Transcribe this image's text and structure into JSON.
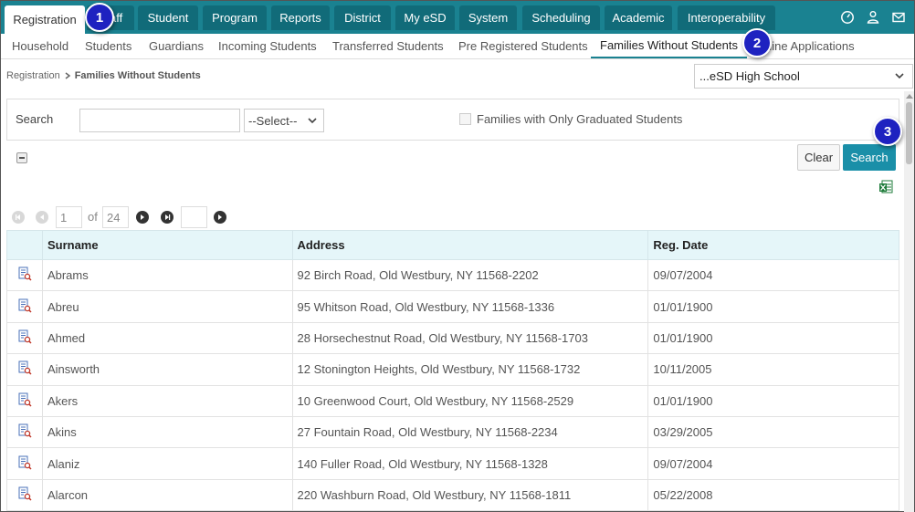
{
  "topnav": {
    "tabs": [
      {
        "label": "Registration",
        "active": true
      },
      {
        "label": "Staff",
        "active": false
      },
      {
        "label": "Student",
        "active": false
      },
      {
        "label": "Program",
        "active": false
      },
      {
        "label": "Reports",
        "active": false
      },
      {
        "label": "District",
        "active": false
      },
      {
        "label": "My eSD",
        "active": false
      },
      {
        "label": "System",
        "active": false
      },
      {
        "label": "Scheduling",
        "active": false
      },
      {
        "label": "Academic",
        "active": false
      },
      {
        "label": "Interoperability",
        "active": false
      }
    ],
    "icons": [
      "dashboard-icon",
      "user-settings-icon",
      "mail-icon"
    ]
  },
  "subnav": {
    "tabs": [
      {
        "label": "Household",
        "active": false
      },
      {
        "label": "Students",
        "active": false
      },
      {
        "label": "Guardians",
        "active": false
      },
      {
        "label": "Incoming Students",
        "active": false
      },
      {
        "label": "Transferred Students",
        "active": false
      },
      {
        "label": "Pre Registered Students",
        "active": false
      },
      {
        "label": "Families Without Students",
        "active": true
      },
      {
        "label": "Online Applications",
        "active": false
      }
    ]
  },
  "breadcrumb": {
    "root": "Registration",
    "current": "Families Without Students"
  },
  "school_select": {
    "value": "...eSD High School"
  },
  "search": {
    "label": "Search",
    "input_value": "",
    "select_value": "--Select--",
    "checkbox_label": "Families with Only Graduated Students",
    "checkbox_checked": false,
    "clear_label": "Clear",
    "search_label": "Search"
  },
  "pager": {
    "current_page": "1",
    "of_label": "of",
    "total_pages": "24",
    "goto_value": ""
  },
  "table": {
    "columns": [
      "",
      "Surname",
      "Address",
      "Reg. Date"
    ],
    "rows": [
      {
        "surname": "Abrams",
        "address": "92 Birch Road, Old Westbury, NY 11568-2202",
        "reg_date": "09/07/2004"
      },
      {
        "surname": "Abreu",
        "address": "95 Whitson Road, Old Westbury, NY 11568-1336",
        "reg_date": "01/01/1900"
      },
      {
        "surname": "Ahmed",
        "address": "28 Horsechestnut Road, Old Westbury, NY 11568-1703",
        "reg_date": "01/01/1900"
      },
      {
        "surname": "Ainsworth",
        "address": "12 Stonington Heights, Old Westbury, NY 11568-1732",
        "reg_date": "10/11/2005"
      },
      {
        "surname": "Akers",
        "address": "10 Greenwood Court, Old Westbury, NY 11568-2529",
        "reg_date": "01/01/1900"
      },
      {
        "surname": "Akins",
        "address": "27 Fountain Road, Old Westbury, NY 11568-2234",
        "reg_date": "03/29/2005"
      },
      {
        "surname": "Alaniz",
        "address": "140 Fuller Road, Old Westbury, NY 11568-1328",
        "reg_date": "09/07/2004"
      },
      {
        "surname": "Alarcon",
        "address": "220 Washburn Road, Old Westbury, NY 11568-1811",
        "reg_date": "05/22/2008"
      }
    ]
  },
  "callouts": [
    "1",
    "2",
    "3"
  ],
  "colors": {
    "nav_bg": "#1a8291",
    "tab_bg": "#116b79",
    "accent": "#1a8fa8",
    "header_bg": "#e5f6f9",
    "callout": "#1e22c0"
  }
}
